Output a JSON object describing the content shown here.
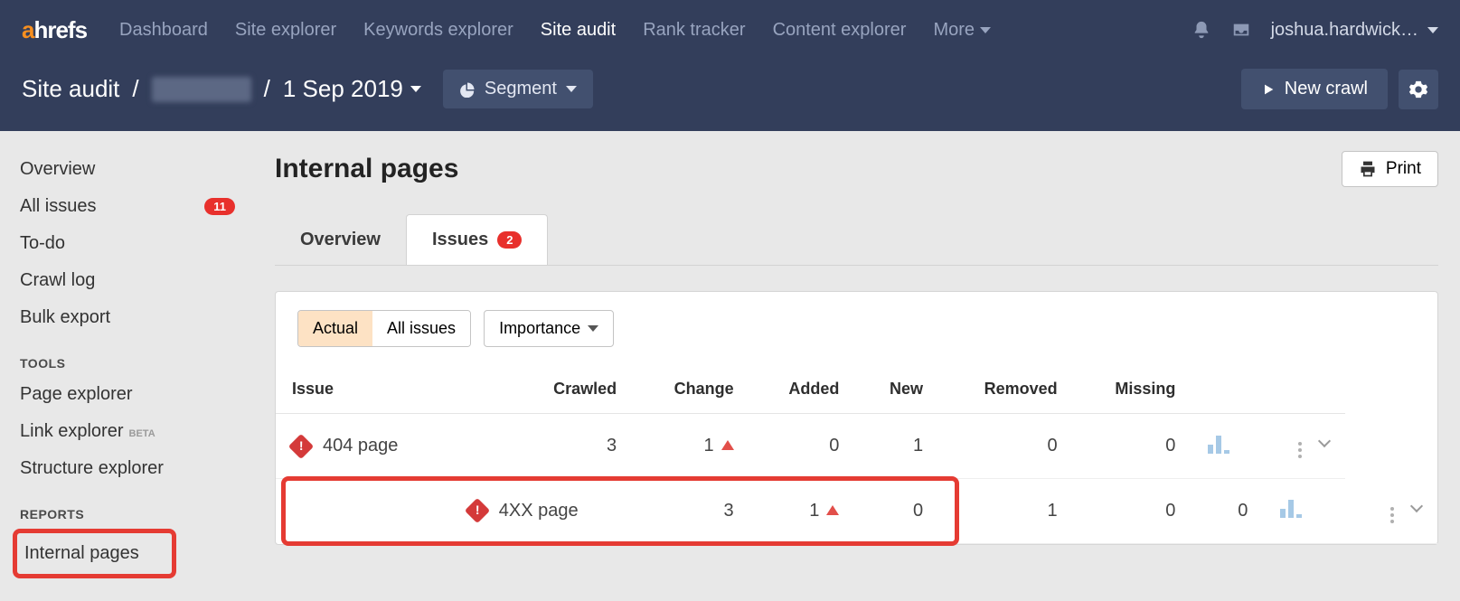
{
  "topnav": {
    "logo_a": "a",
    "logo_rest": "hrefs",
    "items": [
      {
        "label": "Dashboard"
      },
      {
        "label": "Site explorer"
      },
      {
        "label": "Keywords explorer"
      },
      {
        "label": "Site audit",
        "active": true
      },
      {
        "label": "Rank tracker"
      },
      {
        "label": "Content explorer"
      },
      {
        "label": "More"
      }
    ],
    "user": "joshua.hardwick…"
  },
  "subnav": {
    "root": "Site audit",
    "date": "1 Sep 2019",
    "segment_label": "Segment",
    "newcrawl_label": "New crawl"
  },
  "sidebar": {
    "primary": [
      {
        "label": "Overview"
      },
      {
        "label": "All issues",
        "badge": "11"
      },
      {
        "label": "To-do"
      },
      {
        "label": "Crawl log"
      },
      {
        "label": "Bulk export"
      }
    ],
    "tools_header": "TOOLS",
    "tools": [
      {
        "label": "Page explorer"
      },
      {
        "label": "Link explorer",
        "beta": "BETA"
      },
      {
        "label": "Structure explorer"
      }
    ],
    "reports_header": "REPORTS",
    "reports": [
      {
        "label": "Internal pages",
        "active": true
      }
    ]
  },
  "main": {
    "title": "Internal pages",
    "print_label": "Print",
    "tabs": [
      {
        "label": "Overview"
      },
      {
        "label": "Issues",
        "badge": "2",
        "active": true
      }
    ],
    "filters": {
      "actual": "Actual",
      "allissues": "All issues",
      "importance": "Importance"
    },
    "table": {
      "headers": [
        "Issue",
        "Crawled",
        "Change",
        "Added",
        "New",
        "Removed",
        "Missing"
      ],
      "rows": [
        {
          "name": "404 page",
          "crawled": "3",
          "change": "1",
          "added": "0",
          "new": "1",
          "removed": "0",
          "missing": "0"
        },
        {
          "name": "4XX page",
          "crawled": "3",
          "change": "1",
          "added": "0",
          "new": "1",
          "removed": "0",
          "missing": "0",
          "highlight": true
        }
      ]
    }
  }
}
